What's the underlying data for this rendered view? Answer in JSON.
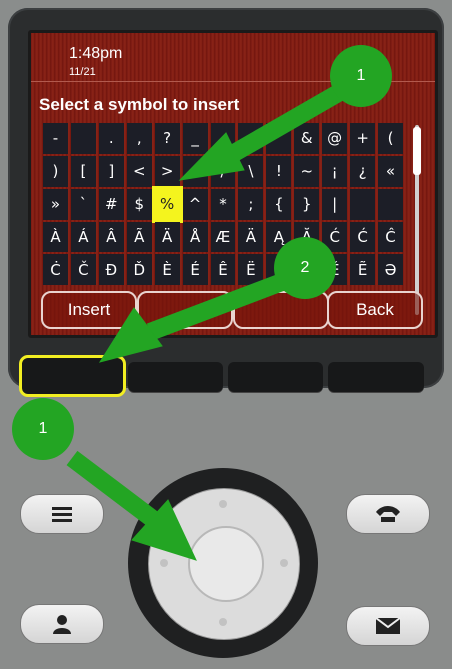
{
  "screen": {
    "time": "1:48pm",
    "date": "11/21",
    "title": "Select a symbol to insert",
    "symbols": [
      [
        "-",
        "",
        ".",
        ",",
        "?",
        "_",
        "",
        "",
        "",
        "&",
        "@",
        "+",
        "("
      ],
      [
        ")",
        "[",
        "]",
        "<",
        ">",
        "",
        "/",
        "\\",
        "!",
        "~",
        "¡",
        "¿",
        "«"
      ],
      [
        "»",
        "`",
        "#",
        "$",
        "%",
        "^",
        "*",
        ";",
        "{",
        "}",
        "|",
        "",
        ""
      ],
      [
        "À",
        "Á",
        "Â",
        "Ã",
        "Ä",
        "Å",
        "Æ",
        "Ä",
        "Ą",
        "Ă",
        "Ć",
        "Ć",
        "Ĉ"
      ],
      [
        "Ċ",
        "Č",
        "Đ",
        "Ď",
        "È",
        "É",
        "Ê",
        "Ë",
        "",
        "Ę",
        "Ě",
        "Ẽ",
        "Ə"
      ]
    ],
    "selected_symbol": "%",
    "softkeys": [
      "Insert",
      "",
      "",
      "Back"
    ]
  },
  "annotations": {
    "badge_top": "1",
    "badge_middle": "2",
    "badge_bottom": "1"
  },
  "colors": {
    "highlight": "#f4f41e",
    "arrow": "#23a523"
  },
  "icons": {
    "left_top_button": "menu-icon",
    "left_bottom_button": "contacts-icon",
    "right_top_button": "handset-icon",
    "right_bottom_button": "mail-icon"
  }
}
